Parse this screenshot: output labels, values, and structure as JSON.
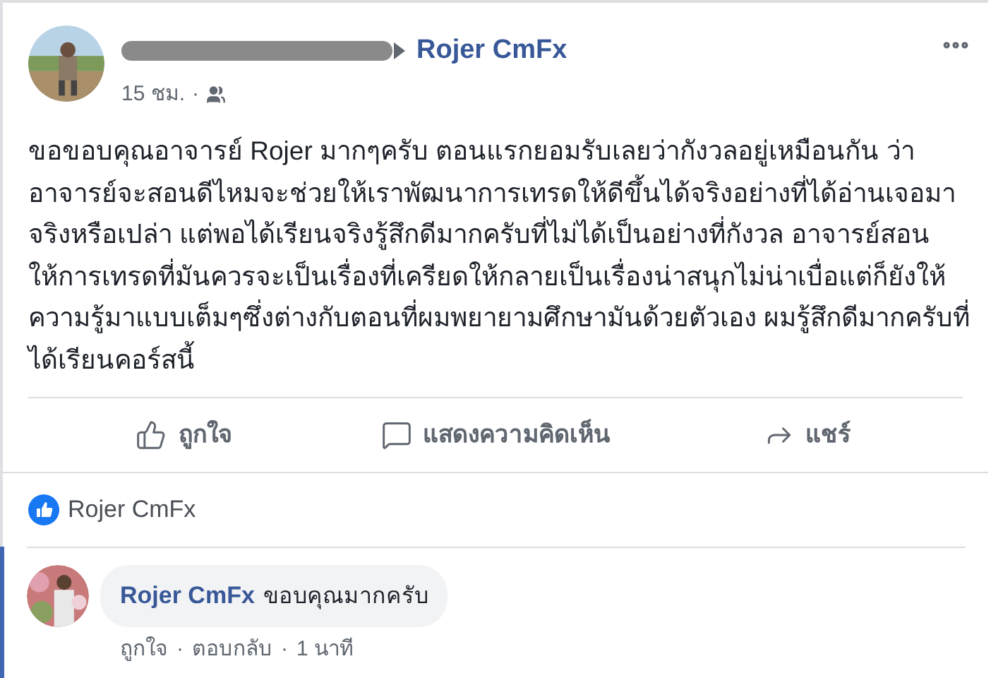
{
  "post": {
    "target": "Rojer CmFx",
    "time": "15 ชม.",
    "separator": "·",
    "body": "ขอขอบคุณอาจารย์ Rojer มากๆครับ ตอนแรกยอมรับเลยว่ากังวลอยู่เหมือนกัน ว่าอาจารย์จะสอนดีไหมจะช่วยให้เราพัฒนาการเทรดให้ดีขึ้นได้จริงอย่างที่ได้อ่านเจอมาจริงหรือเปล่า แต่พอได้เรียนจริงรู้สึกดีมากครับที่ไม่ได้เป็นอย่างที่กังวล อาจารย์สอนให้การเทรดที่มันควรจะเป็นเรื่องที่เครียดให้กลายเป็นเรื่องน่าสนุกไม่น่าเบื่อแต่ก็ยังให้ความรู้มาแบบเต็มๆซึ่งต่างกับตอนที่ผมพยายามศึกษามันด้วยตัวเอง ผมรู้สึกดีมากครับที่ได้เรียนคอร์สนี้"
  },
  "actions": [
    {
      "kind": "like",
      "label": "ถูกใจ"
    },
    {
      "kind": "comment",
      "label": "แสดงความคิดเห็น"
    },
    {
      "kind": "share",
      "label": "แชร์"
    }
  ],
  "likes": {
    "names": "Rojer CmFx"
  },
  "comment": {
    "author": "Rojer CmFx",
    "text": "ขอบคุณมากครับ",
    "actions": [
      "ถูกใจ",
      "ตอบกลับ"
    ],
    "separator": "·",
    "time": "1 นาที"
  }
}
